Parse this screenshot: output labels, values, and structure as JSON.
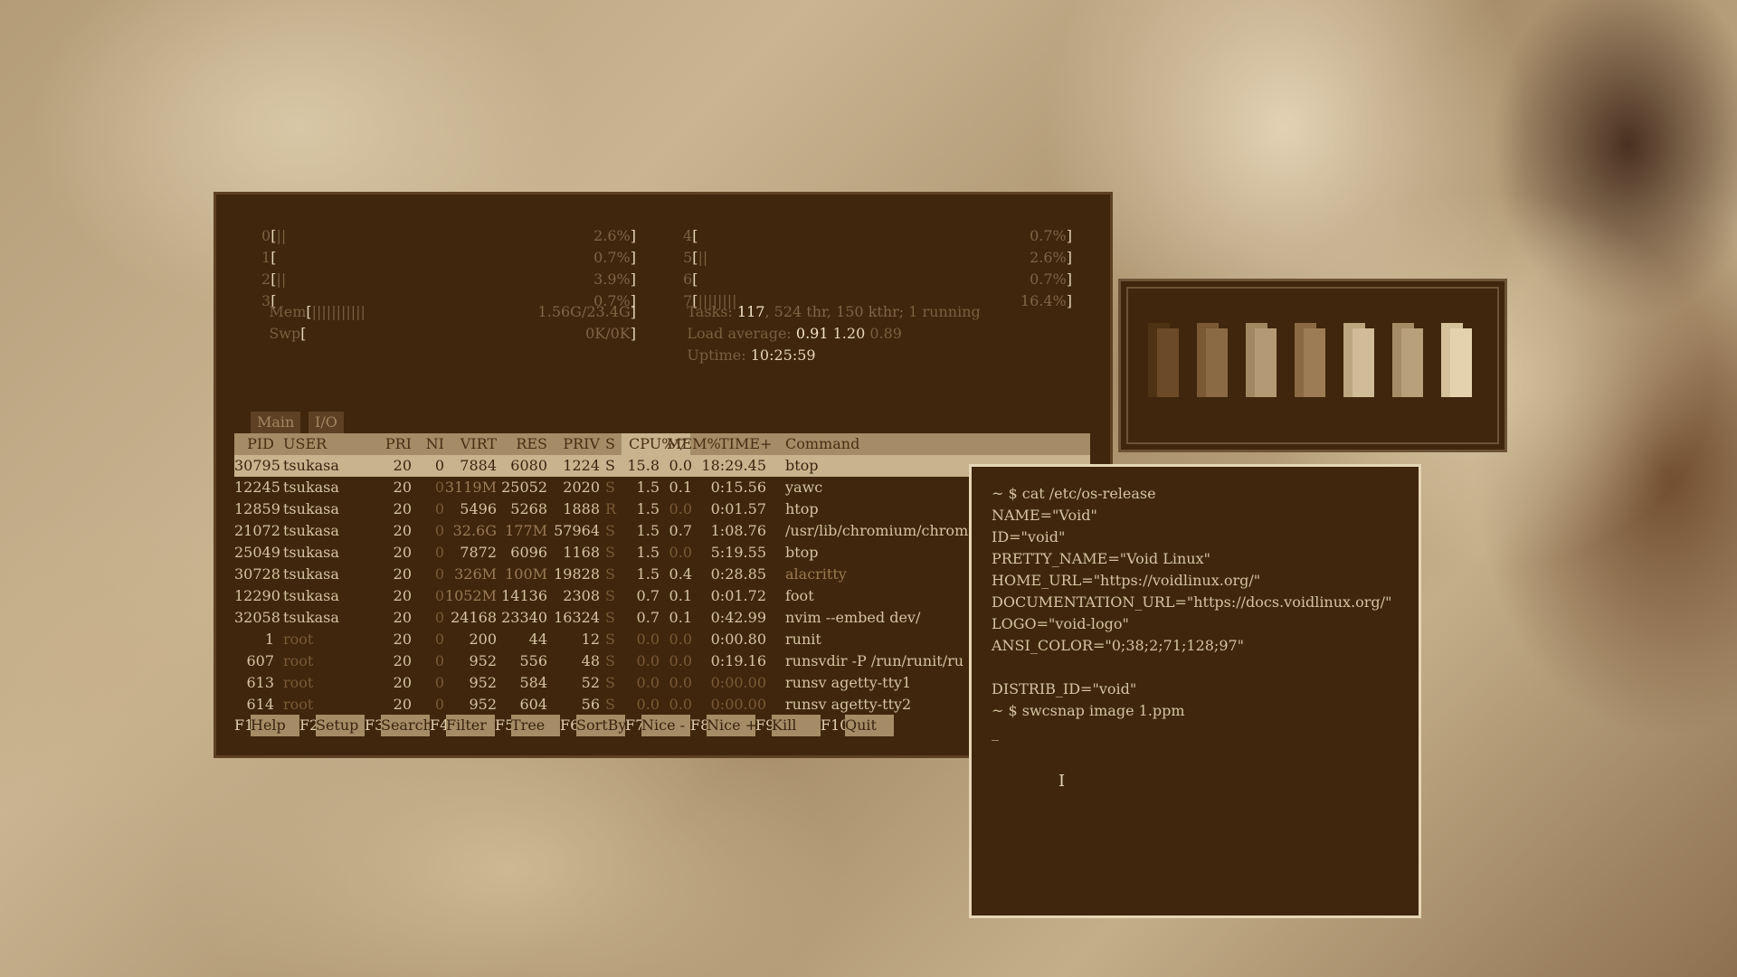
{
  "htop": {
    "cpus_left": [
      {
        "id": "0",
        "bar": "||",
        "pct": "2.6%"
      },
      {
        "id": "1",
        "bar": "",
        "pct": "0.7%"
      },
      {
        "id": "2",
        "bar": "||",
        "pct": "3.9%"
      },
      {
        "id": "3",
        "bar": "",
        "pct": "0.7%"
      }
    ],
    "cpus_right": [
      {
        "id": "4",
        "bar": "",
        "pct": "0.7%"
      },
      {
        "id": "5",
        "bar": "||",
        "pct": "2.6%"
      },
      {
        "id": "6",
        "bar": "",
        "pct": "0.7%"
      },
      {
        "id": "7",
        "bar": "||||||||",
        "pct": "16.4%"
      }
    ],
    "mem": {
      "label": "Mem",
      "bar": "|||||||||||",
      "value": "1.56G/23.4G"
    },
    "swp": {
      "label": "Swp",
      "bar": "",
      "value": "0K/0K"
    },
    "tasks": {
      "label": "Tasks:",
      "count": "117",
      "thr": ", 524 thr, 150 kthr;",
      "running": "1 running"
    },
    "load": {
      "label": "Load average:",
      "v1": "0.91",
      "v2": "1.20",
      "v3": "0.89"
    },
    "uptime": {
      "label": "Uptime:",
      "value": "10:25:59"
    },
    "tabs": [
      "Main",
      "I/O"
    ],
    "columns": [
      "PID",
      "USER",
      "PRI",
      "NI",
      "VIRT",
      "RES",
      "PRIV",
      "S",
      "CPU%▽",
      "MEM%",
      "TIME+",
      "Command"
    ],
    "processes": [
      {
        "pid": "30795",
        "user": "tsukasa",
        "pri": "20",
        "ni": "0",
        "virt": "7884",
        "res": "6080",
        "priv": "1224",
        "s": "S",
        "cpu": "15.8",
        "mem": "0.0",
        "time": "18:29.45",
        "cmd": "btop",
        "dimuser": false
      },
      {
        "pid": "12245",
        "user": "tsukasa",
        "pri": "20",
        "ni": "0",
        "virt": "3119M",
        "res": "25052",
        "priv": "2020",
        "s": "S",
        "cpu": "1.5",
        "mem": "0.1",
        "time": "0:15.56",
        "cmd": "yawc",
        "dimuser": false
      },
      {
        "pid": "12859",
        "user": "tsukasa",
        "pri": "20",
        "ni": "0",
        "virt": "5496",
        "res": "5268",
        "priv": "1888",
        "s": "R",
        "cpu": "1.5",
        "mem": "0.0",
        "time": "0:01.57",
        "cmd": "htop",
        "dimuser": false
      },
      {
        "pid": "21072",
        "user": "tsukasa",
        "pri": "20",
        "ni": "0",
        "virt": "32.6G",
        "res": "177M",
        "priv": "57964",
        "s": "S",
        "cpu": "1.5",
        "mem": "0.7",
        "time": "1:08.76",
        "cmd": "/usr/lib/chromium/chromiu",
        "dimuser": false
      },
      {
        "pid": "25049",
        "user": "tsukasa",
        "pri": "20",
        "ni": "0",
        "virt": "7872",
        "res": "6096",
        "priv": "1168",
        "s": "S",
        "cpu": "1.5",
        "mem": "0.0",
        "time": "5:19.55",
        "cmd": "btop",
        "dimuser": false
      },
      {
        "pid": "30728",
        "user": "tsukasa",
        "pri": "20",
        "ni": "0",
        "virt": "326M",
        "res": "100M",
        "priv": "19828",
        "s": "S",
        "cpu": "1.5",
        "mem": "0.4",
        "time": "0:28.85",
        "cmd": "alacritty",
        "dimuser": false
      },
      {
        "pid": "12290",
        "user": "tsukasa",
        "pri": "20",
        "ni": "0",
        "virt": "1052M",
        "res": "14136",
        "priv": "2308",
        "s": "S",
        "cpu": "0.7",
        "mem": "0.1",
        "time": "0:01.72",
        "cmd": "foot",
        "dimuser": false
      },
      {
        "pid": "32058",
        "user": "tsukasa",
        "pri": "20",
        "ni": "0",
        "virt": "24168",
        "res": "23340",
        "priv": "16324",
        "s": "S",
        "cpu": "0.7",
        "mem": "0.1",
        "time": "0:42.99",
        "cmd": "nvim --embed dev/",
        "dimuser": false
      },
      {
        "pid": "1",
        "user": "root",
        "pri": "20",
        "ni": "0",
        "virt": "200",
        "res": "44",
        "priv": "12",
        "s": "S",
        "cpu": "0.0",
        "mem": "0.0",
        "time": "0:00.80",
        "cmd": "runit",
        "dimuser": true
      },
      {
        "pid": "607",
        "user": "root",
        "pri": "20",
        "ni": "0",
        "virt": "952",
        "res": "556",
        "priv": "48",
        "s": "S",
        "cpu": "0.0",
        "mem": "0.0",
        "time": "0:19.16",
        "cmd": "runsvdir -P /run/runit/ru",
        "dimuser": true
      },
      {
        "pid": "613",
        "user": "root",
        "pri": "20",
        "ni": "0",
        "virt": "952",
        "res": "584",
        "priv": "52",
        "s": "S",
        "cpu": "0.0",
        "mem": "0.0",
        "time": "0:00.00",
        "cmd": "runsv agetty-tty1",
        "dimuser": true
      },
      {
        "pid": "614",
        "user": "root",
        "pri": "20",
        "ni": "0",
        "virt": "952",
        "res": "604",
        "priv": "56",
        "s": "S",
        "cpu": "0.0",
        "mem": "0.0",
        "time": "0:00.00",
        "cmd": "runsv agetty-tty2",
        "dimuser": true
      }
    ],
    "fkeys": [
      {
        "key": "F1",
        "label": "Help  "
      },
      {
        "key": "F2",
        "label": "Setup "
      },
      {
        "key": "F3",
        "label": "Search"
      },
      {
        "key": "F4",
        "label": "Filter"
      },
      {
        "key": "F5",
        "label": "Tree  "
      },
      {
        "key": "F6",
        "label": "SortBy"
      },
      {
        "key": "F7",
        "label": "Nice -"
      },
      {
        "key": "F8",
        "label": "Nice +"
      },
      {
        "key": "F9",
        "label": "Kill  "
      },
      {
        "key": "F10",
        "label": "Quit  "
      }
    ]
  },
  "palette": {
    "colors": [
      {
        "a": "#6b4a27",
        "b": "#4e3214"
      },
      {
        "a": "#8a6a44",
        "b": "#7a5a36"
      },
      {
        "a": "#b49a74",
        "b": "#a28862"
      },
      {
        "a": "#9c7c54",
        "b": "#8a6a44"
      },
      {
        "a": "#d0bc98",
        "b": "#bca67f"
      },
      {
        "a": "#b8a07a",
        "b": "#a68c66"
      },
      {
        "a": "#e4d2ae",
        "b": "#d4c19c"
      }
    ]
  },
  "terminal": {
    "lines": [
      "~ $ cat /etc/os-release",
      "NAME=\"Void\"",
      "ID=\"void\"",
      "PRETTY_NAME=\"Void Linux\"",
      "HOME_URL=\"https://voidlinux.org/\"",
      "DOCUMENTATION_URL=\"https://docs.voidlinux.org/\"",
      "LOGO=\"void-logo\"",
      "ANSI_COLOR=\"0;38;2;71;128;97\"",
      "",
      "DISTRIB_ID=\"void\"",
      "~ $ swcsnap image 1.ppm",
      "_"
    ]
  }
}
